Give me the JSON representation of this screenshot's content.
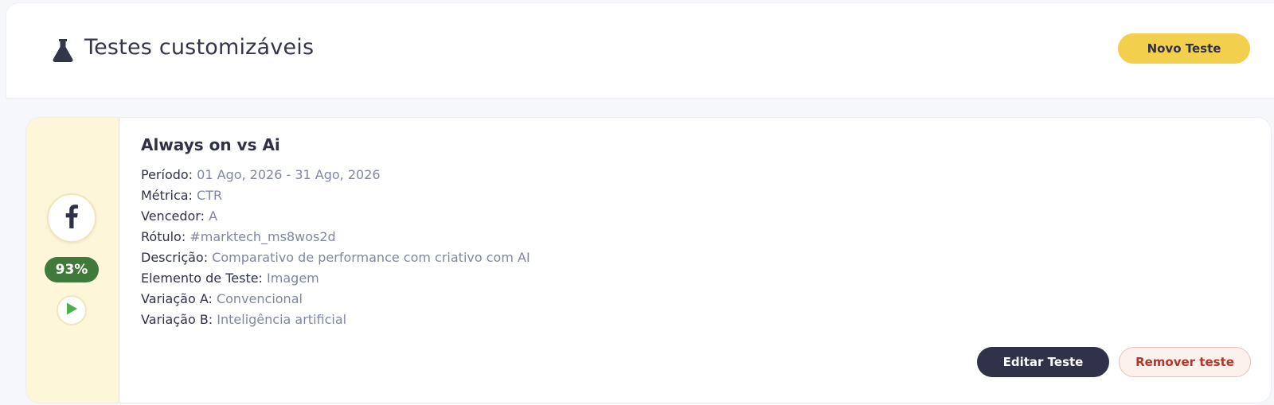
{
  "header": {
    "title": "Testes customizáveis",
    "new_test_label": "Novo Teste",
    "icon": "flask-icon"
  },
  "test": {
    "name": "Always on vs Ai",
    "platform_icon": "facebook-icon",
    "score": "93%",
    "details": [
      {
        "label": "Período:",
        "value": "01 Ago, 2026 - 31 Ago, 2026"
      },
      {
        "label": "Métrica:",
        "value": "CTR"
      },
      {
        "label": "Vencedor:",
        "value": "A"
      },
      {
        "label": "Rótulo:",
        "value": "#marktech_ms8wos2d"
      },
      {
        "label": "Descrição:",
        "value": "Comparativo de performance com criativo com AI"
      },
      {
        "label": "Elemento de Teste:",
        "value": "Imagem"
      },
      {
        "label": "Variação A:",
        "value": "Convencional"
      },
      {
        "label": "Variação B:",
        "value": "Inteligência artificial"
      }
    ],
    "edit_label": "Editar Teste",
    "remove_label": "Remover teste"
  },
  "colors": {
    "accent_yellow": "#f2cf4d",
    "side_panel": "#fdf6d9",
    "score_green": "#3f7a3a",
    "play_green": "#4caf50",
    "dark_button": "#30324a",
    "remove_text": "#b0382a"
  }
}
